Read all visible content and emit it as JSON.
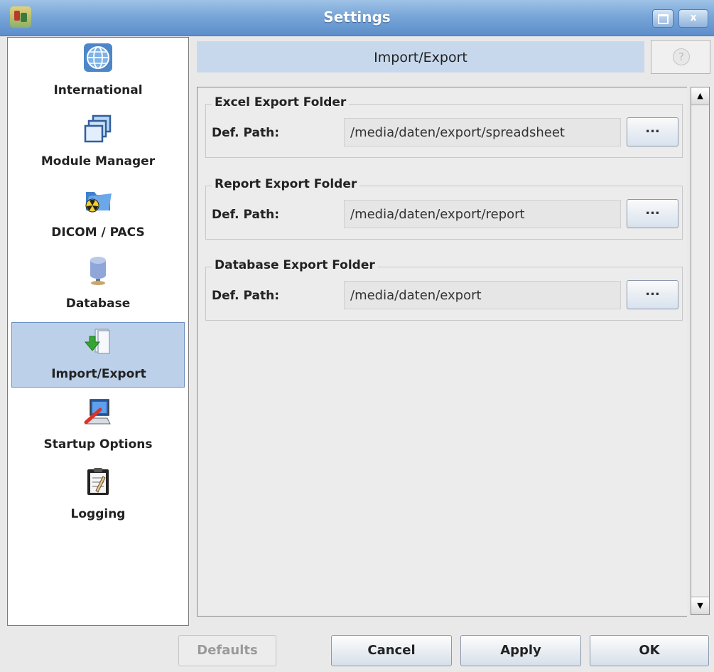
{
  "window": {
    "title": "Settings",
    "app_icon": "app-logo-icon",
    "maximize_icon": "maximize-icon",
    "close_label": "x"
  },
  "sidebar": {
    "items": [
      {
        "label": "International",
        "icon": "globe-icon",
        "selected": false
      },
      {
        "label": "Module Manager",
        "icon": "windows-stack-icon",
        "selected": false
      },
      {
        "label": "DICOM / PACS",
        "icon": "radiation-folder-icon",
        "selected": false
      },
      {
        "label": "Database",
        "icon": "database-icon",
        "selected": true
      },
      {
        "label": "Import/Export",
        "icon": "import-export-icon",
        "selected": true
      },
      {
        "label": "Startup Options",
        "icon": "startup-monitor-icon",
        "selected": false
      },
      {
        "label": "Logging",
        "icon": "clipboard-icon",
        "selected": false
      }
    ]
  },
  "header": {
    "title": "Import/Export",
    "help_label": "?"
  },
  "groups": [
    {
      "title": "Excel Export Folder",
      "field_label": "Def. Path:",
      "path": "/media/daten/export/spreadsheet",
      "button": "..."
    },
    {
      "title": "Report Export Folder",
      "field_label": "Def. Path:",
      "path": "/media/daten/export/report",
      "button": "..."
    },
    {
      "title": "Database Export Folder",
      "field_label": "Def. Path:",
      "path": "/media/daten/export",
      "button": "..."
    }
  ],
  "footer": {
    "defaults": "Defaults",
    "cancel": "Cancel",
    "apply": "Apply",
    "ok": "OK"
  },
  "colors": {
    "titlebar": "#78a6d8",
    "selected": "#bcd0ea",
    "header": "#c8d8ec"
  }
}
